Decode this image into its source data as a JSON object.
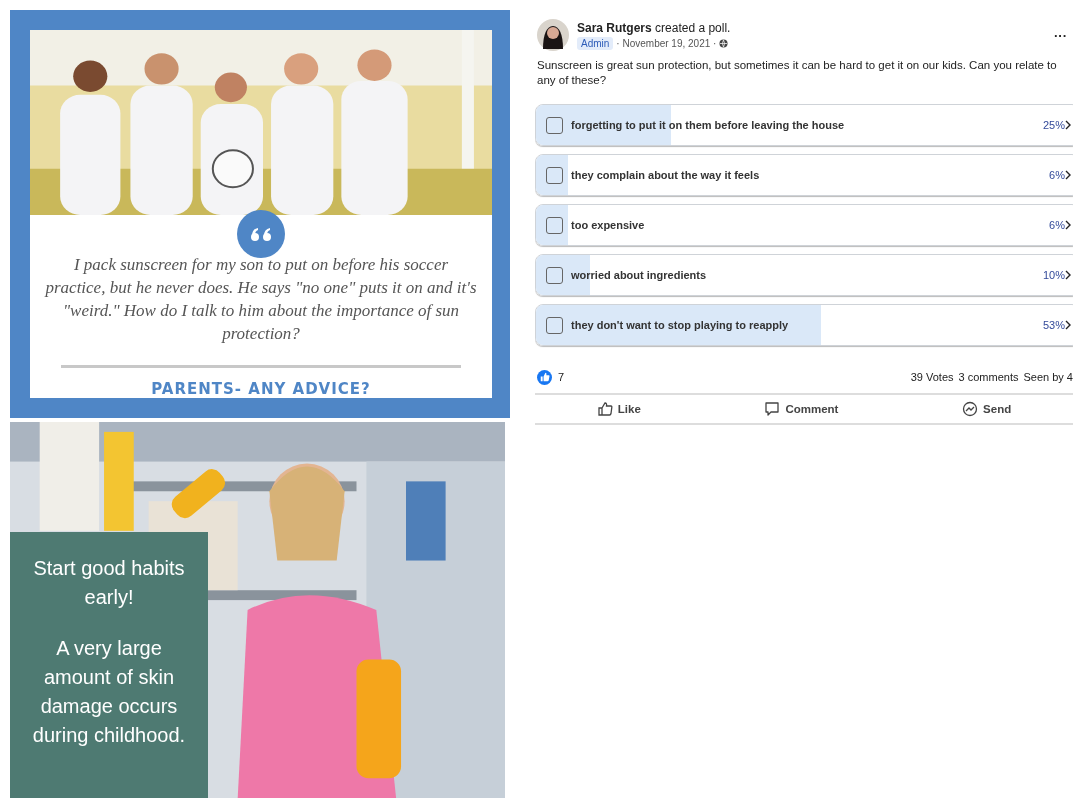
{
  "quote_card": {
    "kind": "picture",
    "quote": "I pack sunscreen for my son to put on before his soccer practice, but he never does.  He says \"no one\" puts it on and it's \"weird.\" How do I talk to him about the importance of sun protection?",
    "call_to_action": "PARENTS- ANY ADVICE?"
  },
  "promo_card": {
    "kind": "picture",
    "headline": "Start good habits early!",
    "body": "A very large amount of skin damage occurs during childhood."
  },
  "post": {
    "author": "Sara Rutgers",
    "action": "created a poll.",
    "badge": "Admin",
    "date": "· November 19, 2021 ·",
    "more": "···",
    "text": "Sunscreen is great sun protection, but sometimes it can be hard to get it on our kids.  Can you relate to any of these?",
    "options": [
      {
        "label": "forgetting to put it on them before leaving the house",
        "percent": "25%",
        "level": 0.25,
        "checked": false
      },
      {
        "label": "they complain about the way it feels",
        "percent": "6%",
        "level": 0.06,
        "checked": false
      },
      {
        "label": "too expensive",
        "percent": "6%",
        "level": 0.06,
        "checked": false
      },
      {
        "label": "worried about ingredients",
        "percent": "10%",
        "level": 0.1,
        "checked": false
      },
      {
        "label": "they don't want to stop playing to reapply",
        "percent": "53%",
        "level": 0.53,
        "checked": false
      }
    ],
    "reactions": "7",
    "votes": "39 Votes",
    "comments": "3 comments",
    "seen": "Seen by 4",
    "actions": [
      {
        "kind": "like",
        "label": "Like"
      },
      {
        "kind": "comment",
        "label": "Comment"
      },
      {
        "kind": "send",
        "label": "Send"
      }
    ]
  }
}
